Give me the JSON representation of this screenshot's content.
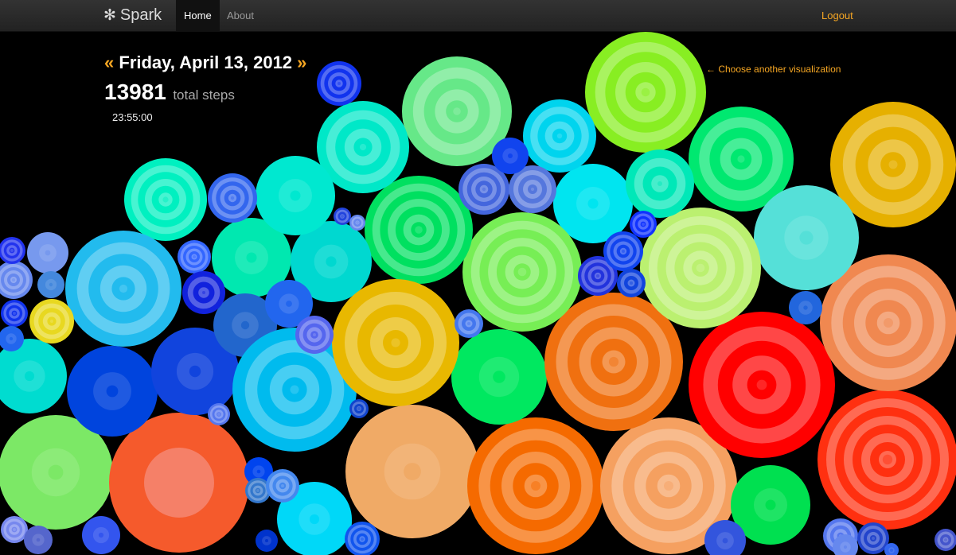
{
  "navbar": {
    "brand_icon": "✻",
    "brand": "Spark",
    "home": "Home",
    "about": "About",
    "logout": "Logout"
  },
  "date_nav": {
    "prev": "«",
    "date": "Friday, April 13, 2012",
    "next": "»"
  },
  "summary": {
    "steps": "13981",
    "steps_label": "total steps",
    "time": "23:55:00"
  },
  "choose_link": "← Choose another visualization",
  "colors": {
    "accent": "#f5a623",
    "navbar": "#2b2b2b",
    "background": "#000000"
  },
  "circles": [
    {
      "c": "#7ce866"
    },
    {
      "c": "#f55a2c",
      "a": "#f58068"
    },
    {
      "c": "#00d8e8"
    },
    {
      "c": "#0044ee"
    },
    {
      "c": "#3355ee"
    },
    {
      "c": "#e6b000"
    },
    {
      "c": "#f0aa66"
    },
    {
      "c": "#f56a00"
    },
    {
      "c": "#f5a060"
    },
    {
      "c": "#ff3010"
    },
    {
      "c": "#00e860"
    },
    {
      "c": "#ff0000"
    },
    {
      "c": "#f07010"
    },
    {
      "c": "#f08850"
    },
    {
      "c": "#00e050"
    },
    {
      "c": "#88ee22"
    },
    {
      "c": "#00e870"
    },
    {
      "c": "#55e0d8"
    },
    {
      "c": "#00e5f0"
    },
    {
      "c": "#00d4ee"
    },
    {
      "c": "#bbf070"
    },
    {
      "c": "#77ee55"
    },
    {
      "c": "#00e060"
    },
    {
      "c": "#66e888"
    },
    {
      "c": "#00e8c8"
    },
    {
      "c": "#00f0c0"
    },
    {
      "c": "#22bbee"
    },
    {
      "c": "#00e8b8"
    },
    {
      "c": "#00e8b0"
    },
    {
      "c": "#00d8d0"
    },
    {
      "c": "#00e8d0"
    },
    {
      "c": "#00dcd0"
    },
    {
      "c": "#0044dd"
    },
    {
      "c": "#1144dd"
    },
    {
      "c": "#7799ee"
    },
    {
      "c": "#2266cc"
    },
    {
      "c": "#2266ee"
    },
    {
      "c": "#00d8f8"
    },
    {
      "c": "#00bbee"
    },
    {
      "c": "#e8b800"
    },
    {
      "c": "#e8d820"
    },
    {
      "c": "#3366ee"
    },
    {
      "c": "#1133ee"
    },
    {
      "c": "#4466dd"
    },
    {
      "c": "#5577dd"
    },
    {
      "c": "#2233dd"
    },
    {
      "c": "#1144ee"
    },
    {
      "c": "#1133ff"
    },
    {
      "c": "#1144dd"
    },
    {
      "c": "#2266dd"
    },
    {
      "c": "#4477ee"
    },
    {
      "c": "#5566ee"
    },
    {
      "c": "#3366ff"
    },
    {
      "c": "#1122dd"
    },
    {
      "c": "#1144ee"
    },
    {
      "c": "#6688ee"
    },
    {
      "c": "#2233ee"
    },
    {
      "c": "#1133ee"
    },
    {
      "c": "#4488dd"
    },
    {
      "c": "#2266ee"
    },
    {
      "c": "#5577ee"
    },
    {
      "c": "#1144cc"
    },
    {
      "c": "#2244dd"
    },
    {
      "c": "#6688ee"
    },
    {
      "c": "#7788ee"
    },
    {
      "c": "#5566cc"
    },
    {
      "c": "#3377cc"
    },
    {
      "c": "#4488ee"
    },
    {
      "c": "#1155ee"
    },
    {
      "c": "#3355dd"
    },
    {
      "c": "#5577ee"
    },
    {
      "c": "#2244cc"
    },
    {
      "c": "#4455cc"
    },
    {
      "c": "#6688ee"
    },
    {
      "c": "#3366ee"
    },
    {
      "c": "#0033cc"
    }
  ]
}
